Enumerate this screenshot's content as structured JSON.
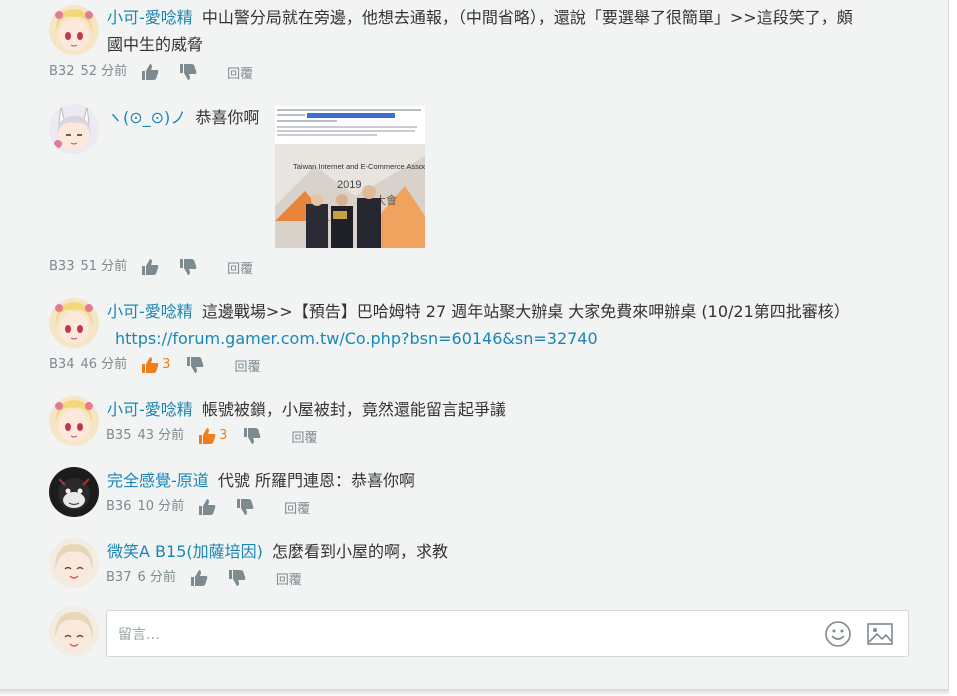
{
  "comments": [
    {
      "user": "小可-愛唸精",
      "text": "中山警分局就在旁邊，他想去通報，（中間省略），還說「要選舉了很簡單」>>這段笑了，頗國中生的威脅",
      "floor": "B32",
      "time": "52 分前",
      "reply": "回覆"
    },
    {
      "user": "ヽ(⊙_⊙)ノ",
      "text": "恭喜你啊",
      "floor": "B33",
      "time": "51 分前",
      "reply": "回覆",
      "attachment": {
        "banner_text": "Taiwan Internet and E-Commerce Associ",
        "year": "2019",
        "sub_text": "大會"
      }
    },
    {
      "user": "小可-愛唸精",
      "text": "這邊戰場>>【預告】巴哈姆特 27 週年站聚大辦桌 大家免費來呷辦桌 (10/21第四批審核）",
      "link": "https://forum.gamer.com.tw/Co.php?bsn=60146&sn=32740",
      "floor": "B34",
      "time": "46 分前",
      "gp": "3",
      "reply": "回覆"
    },
    {
      "user": "小可-愛唸精",
      "text": "帳號被鎖，小屋被封，竟然還能留言起爭議",
      "floor": "B35",
      "time": "43 分前",
      "gp": "3",
      "reply": "回覆"
    },
    {
      "user": "完全感覺-原道",
      "text": "代號 所羅門連恩：恭喜你啊",
      "floor": "B36",
      "time": "10 分前",
      "reply": "回覆"
    },
    {
      "user": "微笑A B15(加薩培因)",
      "text": "怎麼看到小屋的啊，求教",
      "floor": "B37",
      "time": "6 分前",
      "reply": "回覆"
    }
  ],
  "composer": {
    "placeholder": "留言…",
    "emoji_icon": "smile-icon",
    "image_icon": "image-icon"
  },
  "colors": {
    "username": "#1a86b5",
    "gp": "#f07e1a",
    "meta": "#7d8a8f",
    "background": "#f2f4f4"
  }
}
